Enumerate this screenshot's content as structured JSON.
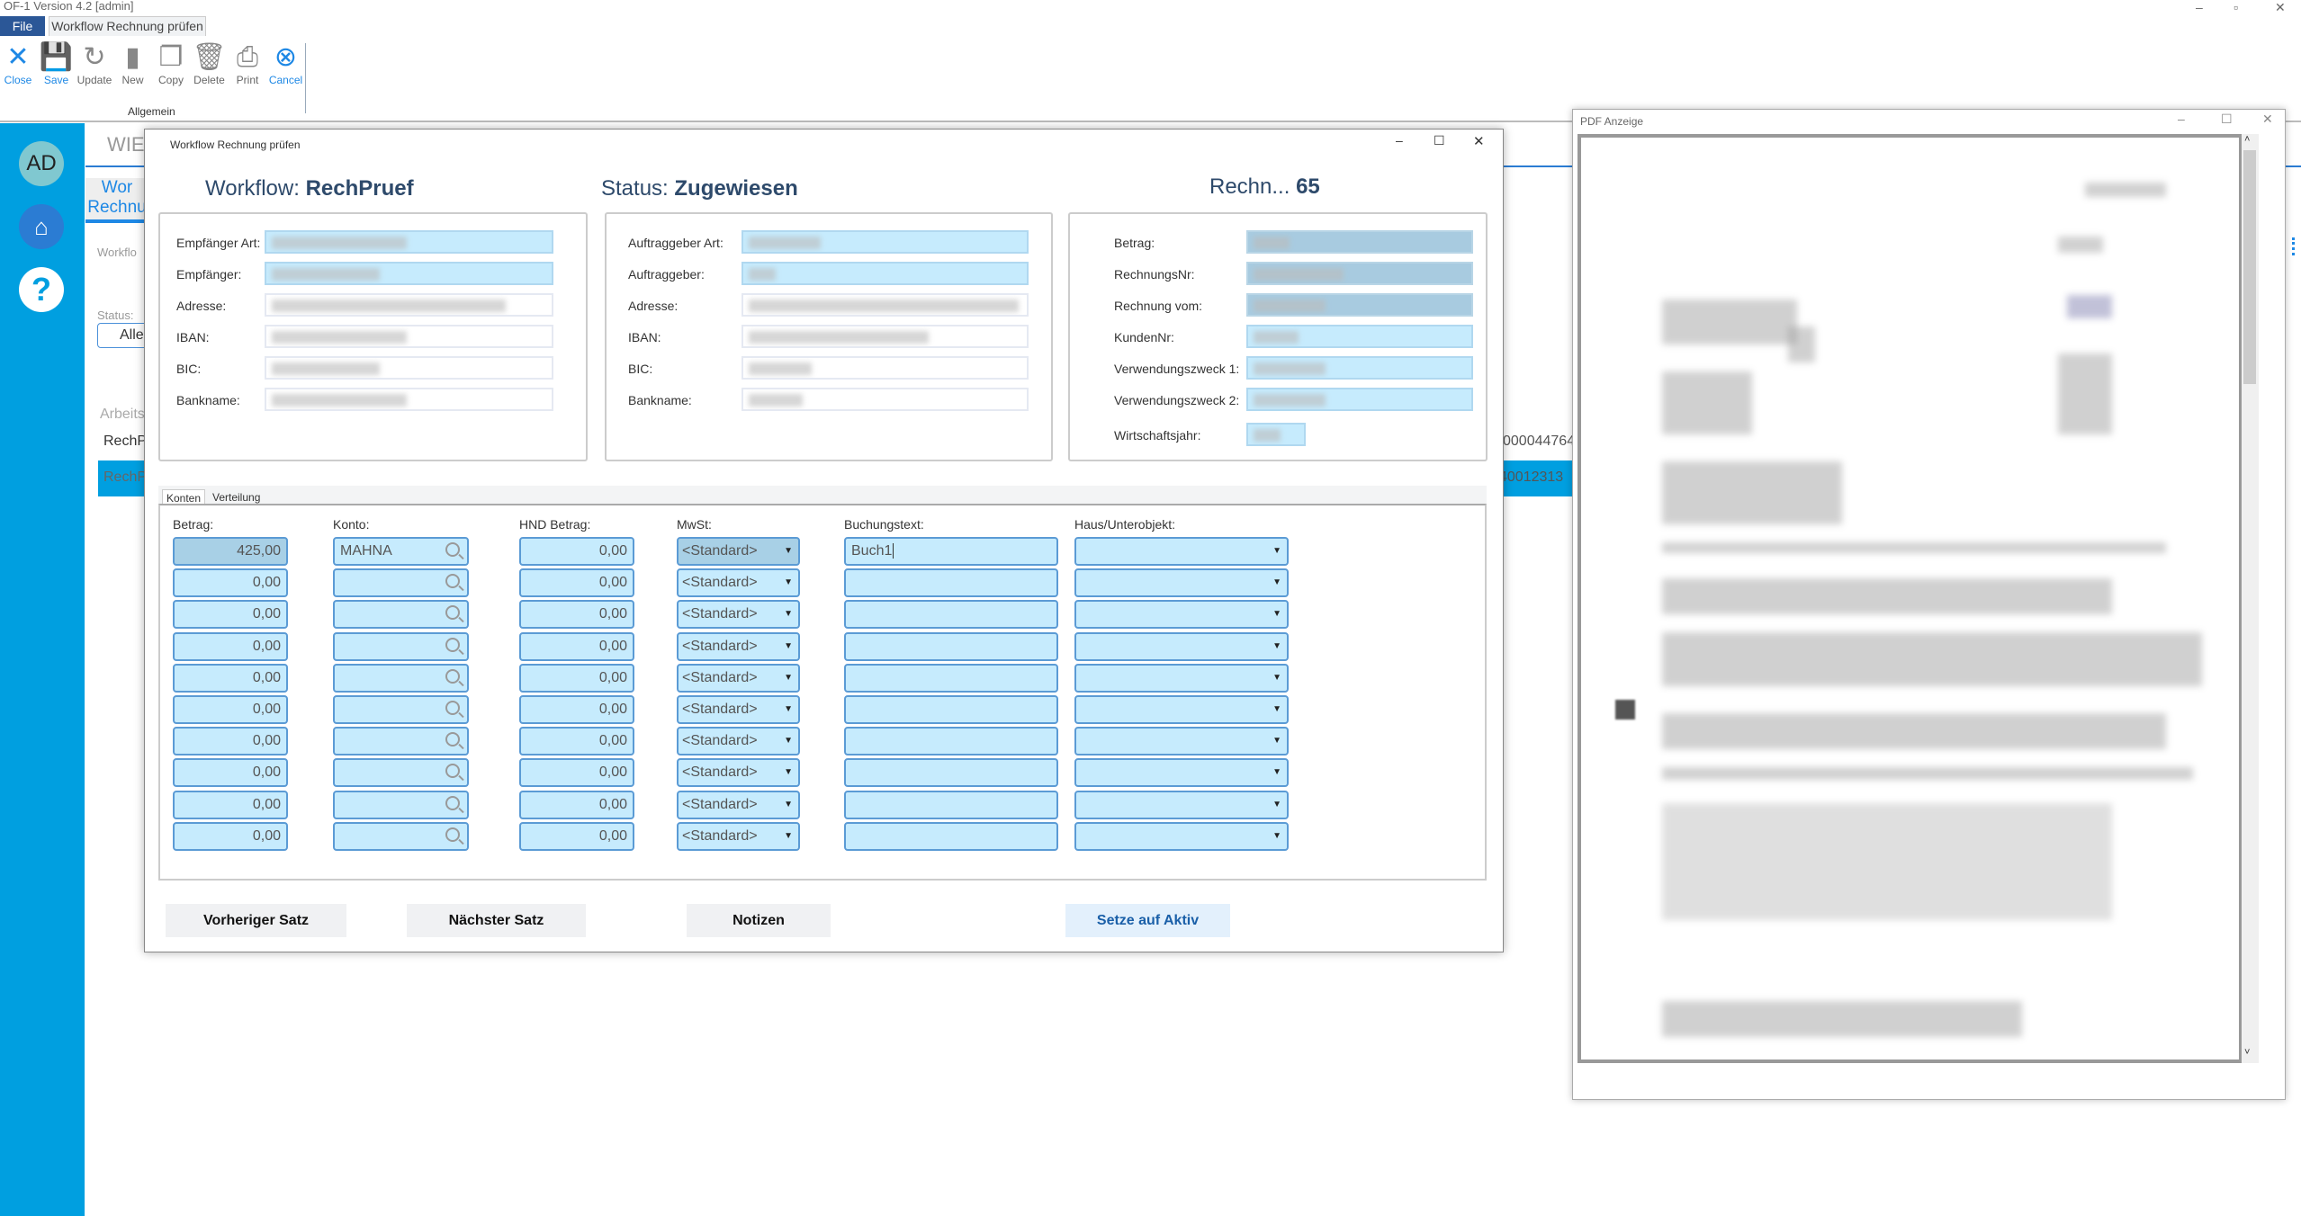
{
  "app": {
    "title": "OF-1  Version 4.2  [admin]",
    "file_tab": "File",
    "doc_tab": "Workflow Rechnung prüfen"
  },
  "ribbon": {
    "buttons": [
      {
        "label": "Close",
        "icon": "close-icon",
        "color": "#1e88e5"
      },
      {
        "label": "Save",
        "icon": "save-icon",
        "color": "#1e88e5"
      },
      {
        "label": "Update",
        "icon": "update-icon",
        "color": "#888888"
      },
      {
        "label": "New",
        "icon": "new-icon",
        "color": "#888888"
      },
      {
        "label": "Copy",
        "icon": "copy-icon",
        "color": "#888888"
      },
      {
        "label": "Delete",
        "icon": "delete-icon",
        "color": "#888888"
      },
      {
        "label": "Print",
        "icon": "print-icon",
        "color": "#888888"
      },
      {
        "label": "Cancel",
        "icon": "cancel-icon",
        "color": "#1e88e5"
      }
    ],
    "group": "Allgemein"
  },
  "sidebar": {
    "avatar": "AD",
    "home_icon": "home-icon",
    "help_icon": "help-icon",
    "color": "#009fe0"
  },
  "background": {
    "header": "WIE",
    "tab_line1": "Wor",
    "tab_line2": "Rechnu",
    "workflow_label": "Workflo",
    "status_label": "Status:",
    "status_value": "Alle",
    "list_label": "Arbeits",
    "row1": "RechP",
    "row2": "RechP",
    "row1_right": "000044764",
    "row2_right": "40012313"
  },
  "dialog": {
    "title": "Workflow Rechnung prüfen",
    "workflow_label": "Workflow:",
    "workflow_value": "RechPruef",
    "status_label": "Status:",
    "status_value": "Zugewiesen",
    "rechn_label": "Rechn...",
    "rechn_value": "65",
    "group1": [
      "Empfänger Art:",
      "Empfänger:",
      "Adresse:",
      "IBAN:",
      "BIC:",
      "Bankname:"
    ],
    "group2": [
      "Auftraggeber Art:",
      "Auftraggeber:",
      "Adresse:",
      "IBAN:",
      "BIC:",
      "Bankname:"
    ],
    "group3": [
      "Betrag:",
      "RechnungsNr:",
      "Rechnung vom:",
      "KundenNr:",
      "Verwendungszweck 1:",
      "Verwendungszweck 2:",
      "Wirtschaftsjahr:"
    ],
    "tabs": [
      "Konten",
      "Verteilung"
    ],
    "columns": [
      "Betrag:",
      "Konto:",
      "HND Betrag:",
      "MwSt:",
      "Buchungstext:",
      "Haus/Unterobjekt:"
    ],
    "rows": [
      {
        "betrag": "425,00",
        "konto": "MAHNA",
        "hnd": "0,00",
        "mwst": "<Standard>",
        "text": "Buch1",
        "haus": ""
      },
      {
        "betrag": "0,00",
        "konto": "",
        "hnd": "0,00",
        "mwst": "<Standard>",
        "text": "",
        "haus": ""
      },
      {
        "betrag": "0,00",
        "konto": "",
        "hnd": "0,00",
        "mwst": "<Standard>",
        "text": "",
        "haus": ""
      },
      {
        "betrag": "0,00",
        "konto": "",
        "hnd": "0,00",
        "mwst": "<Standard>",
        "text": "",
        "haus": ""
      },
      {
        "betrag": "0,00",
        "konto": "",
        "hnd": "0,00",
        "mwst": "<Standard>",
        "text": "",
        "haus": ""
      },
      {
        "betrag": "0,00",
        "konto": "",
        "hnd": "0,00",
        "mwst": "<Standard>",
        "text": "",
        "haus": ""
      },
      {
        "betrag": "0,00",
        "konto": "",
        "hnd": "0,00",
        "mwst": "<Standard>",
        "text": "",
        "haus": ""
      },
      {
        "betrag": "0,00",
        "konto": "",
        "hnd": "0,00",
        "mwst": "<Standard>",
        "text": "",
        "haus": ""
      },
      {
        "betrag": "0,00",
        "konto": "",
        "hnd": "0,00",
        "mwst": "<Standard>",
        "text": "",
        "haus": ""
      },
      {
        "betrag": "0,00",
        "konto": "",
        "hnd": "0,00",
        "mwst": "<Standard>",
        "text": "",
        "haus": ""
      }
    ],
    "buttons": {
      "prev": "Vorheriger Satz",
      "next": "Nächster Satz",
      "notes": "Notizen",
      "activate": "Setze  auf Aktiv"
    }
  },
  "pdf": {
    "title": "PDF Anzeige"
  }
}
